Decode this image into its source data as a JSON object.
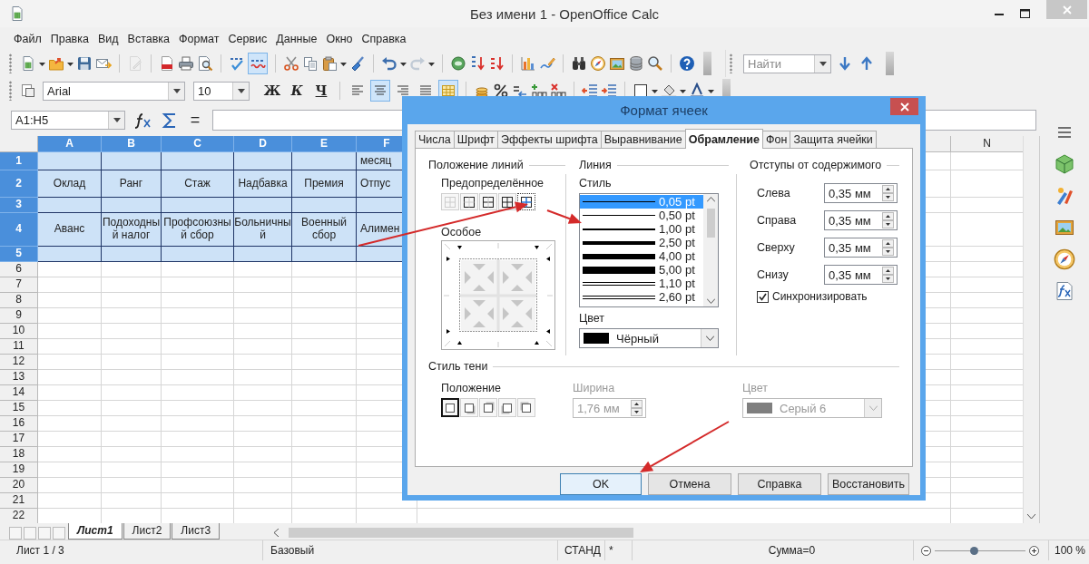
{
  "window": {
    "title": "Без имени 1 - OpenOffice Calc"
  },
  "menu": [
    "Файл",
    "Правка",
    "Вид",
    "Вставка",
    "Формат",
    "Сервис",
    "Данные",
    "Окно",
    "Справка"
  ],
  "standard_toolbar": {
    "edit_file": {
      "disabled": true
    },
    "auto_spellcheck": {
      "on": true
    },
    "redo": {
      "disabled": true
    }
  },
  "find_toolbar": {
    "placeholder": "Найти"
  },
  "formatting_toolbar": {
    "font_name": "Arial",
    "font_size": "10",
    "style_buttons": [
      "Ж",
      "К",
      "Ч"
    ],
    "align_buttons": [
      {
        "selected": false
      },
      {
        "selected": true
      },
      {
        "selected": false
      },
      {
        "selected": false
      }
    ],
    "merge_cells": {
      "on": true
    }
  },
  "formula_bar": {
    "name_box": "A1:H5",
    "equals": "="
  },
  "sheet": {
    "columns": [
      {
        "label": "A",
        "selected": true
      },
      {
        "label": "B",
        "selected": true
      },
      {
        "label": "C",
        "selected": true
      },
      {
        "label": "D",
        "selected": true
      },
      {
        "label": "E",
        "selected": true
      },
      {
        "label": "F",
        "selected": true
      },
      {
        "label": "N",
        "selected": false
      }
    ],
    "rows": [
      {
        "label": "1",
        "selected": true,
        "cells": [
          "",
          "",
          "",
          "",
          "",
          "месяц"
        ]
      },
      {
        "label": "2",
        "selected": true,
        "cells": [
          "Оклад",
          "Ранг",
          "Стаж",
          "Надбавка",
          "Премия",
          "Отпус"
        ]
      },
      {
        "label": "3",
        "selected": true
      },
      {
        "label": "4",
        "selected": true,
        "cells": [
          "Аванс",
          "Подоходный налог",
          "Профсоюзный сбор",
          "Больничный",
          "Военный сбор",
          "Алимен"
        ]
      },
      {
        "label": "5",
        "selected": true
      },
      {
        "label": "6",
        "selected": false
      },
      {
        "label": "7",
        "selected": false
      },
      {
        "label": "8",
        "selected": false
      },
      {
        "label": "9",
        "selected": false
      },
      {
        "label": "10",
        "selected": false
      },
      {
        "label": "11",
        "selected": false
      },
      {
        "label": "12",
        "selected": false
      },
      {
        "label": "13",
        "selected": false
      },
      {
        "label": "14",
        "selected": false
      },
      {
        "label": "15",
        "selected": false
      },
      {
        "label": "16",
        "selected": false
      },
      {
        "label": "17",
        "selected": false
      },
      {
        "label": "18",
        "selected": false
      },
      {
        "label": "19",
        "selected": false
      },
      {
        "label": "20",
        "selected": false
      },
      {
        "label": "21",
        "selected": false
      },
      {
        "label": "22",
        "selected": false
      }
    ]
  },
  "sheet_tabs": [
    {
      "label": "Лист1",
      "selected": true
    },
    {
      "label": "Лист2",
      "selected": false
    },
    {
      "label": "Лист3",
      "selected": false
    }
  ],
  "status_bar": {
    "sheet": "Лист 1 / 3",
    "page_style": "Базовый",
    "mode": "СТАНД",
    "modified": "*",
    "sum": "Сумма=0",
    "zoom": {
      "level": 0.43
    },
    "zoom_value": "100 %"
  },
  "dialog": {
    "title": "Формат ячеек",
    "tabs": [
      {
        "label": "Числа",
        "selected": false
      },
      {
        "label": "Шрифт",
        "selected": false
      },
      {
        "label": "Эффекты шрифта",
        "selected": false
      },
      {
        "label": "Выравнивание",
        "selected": false
      },
      {
        "label": "Обрамление",
        "selected": true
      },
      {
        "label": "Фон",
        "selected": false
      },
      {
        "label": "Защита ячейки",
        "selected": false
      }
    ],
    "line_arrangement": {
      "title": "Положение линий",
      "presets_label": "Предопределённое",
      "presets": [
        {
          "selected": false
        },
        {
          "selected": false
        },
        {
          "selected": false
        },
        {
          "selected": false
        },
        {
          "selected": true
        }
      ],
      "custom_label": "Особое"
    },
    "line": {
      "title": "Линия",
      "style_label": "Стиль",
      "styles": [
        {
          "label": "0,05 pt",
          "kind": "single",
          "selected": true
        },
        {
          "label": "0,50 pt",
          "kind": "single",
          "selected": false
        },
        {
          "label": "1,00 pt",
          "kind": "single",
          "selected": false
        },
        {
          "label": "2,50 pt",
          "kind": "single",
          "selected": false
        },
        {
          "label": "4,00 pt",
          "kind": "single",
          "selected": false
        },
        {
          "label": "5,00 pt",
          "kind": "single",
          "selected": false
        },
        {
          "label": "1,10 pt",
          "kind": "double",
          "selected": false
        },
        {
          "label": "2,60 pt",
          "kind": "double",
          "selected": false
        }
      ],
      "color_label": "Цвет",
      "color": {
        "value": "Чёрный",
        "color": "#000000"
      }
    },
    "spacing": {
      "title": "Отступы от содержимого",
      "fields": [
        {
          "label": "Слева",
          "value": "0,35 мм"
        },
        {
          "label": "Справа",
          "value": "0,35 мм"
        },
        {
          "label": "Сверху",
          "value": "0,35 мм"
        },
        {
          "label": "Снизу",
          "value": "0,35 мм"
        }
      ],
      "synchronize": {
        "label": "Синхронизировать",
        "checked": true
      }
    },
    "shadow": {
      "title": "Стиль тени",
      "position_label": "Положение",
      "positions": [
        {
          "selected": true
        },
        {
          "selected": false
        },
        {
          "selected": false
        },
        {
          "selected": false
        },
        {
          "selected": false
        }
      ],
      "width_label": "Ширина",
      "width": {
        "value": "1,76 мм",
        "disabled": true
      },
      "color_label": "Цвет",
      "color": {
        "value": "Серый 6",
        "color": "#7f7f7f",
        "disabled": true
      }
    },
    "buttons": [
      {
        "label": "OK",
        "focused": true
      },
      {
        "label": "Отмена",
        "focused": false
      },
      {
        "label": "Справка",
        "focused": false
      },
      {
        "label": "Восстановить",
        "focused": false
      }
    ]
  }
}
